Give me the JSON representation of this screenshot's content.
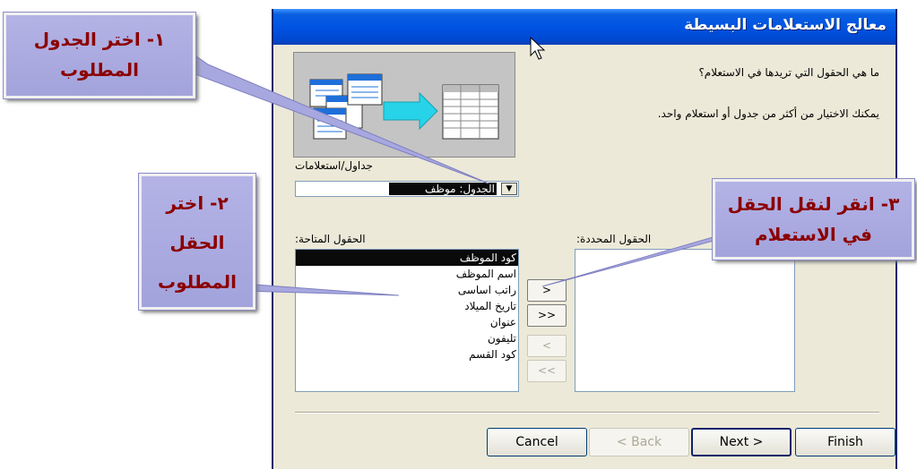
{
  "window": {
    "title": "معالج الاستعلامات البسيطة"
  },
  "prompts": {
    "question": "ما هي الحقول التي تريدها في الاستعلام؟",
    "hint": "يمكنك الاختيار من أكثر من جدول أو استعلام واحد."
  },
  "tables": {
    "label": "جداول/استعلامات",
    "selected": "الجدول: موظف"
  },
  "available": {
    "label": "الحقول المتاحة:",
    "items": [
      "كود الموظف",
      "اسم الموظف",
      "راتب اساسى",
      "تاريخ الميلاد",
      "عنوان",
      "تليفون",
      "كود القسم"
    ],
    "selected_index": 0
  },
  "selected_fields": {
    "label": "الحقول المحددة:"
  },
  "move_buttons": {
    "add": ">",
    "add_all": ">>",
    "remove": "<",
    "remove_all": "<<"
  },
  "buttons": {
    "cancel": "Cancel",
    "back": "< Back",
    "next": "Next >",
    "finish": "Finish"
  },
  "callouts": {
    "one": "١- اختر الجدول المطلوب",
    "two": "٢- اختر الحقل المطلوب",
    "three": "٣- انقر لنقل الحقل في الاستعلام"
  },
  "colors": {
    "titlebar": "#0054e3",
    "callout": "#a8a8e0",
    "callout_text": "#8b0000"
  }
}
